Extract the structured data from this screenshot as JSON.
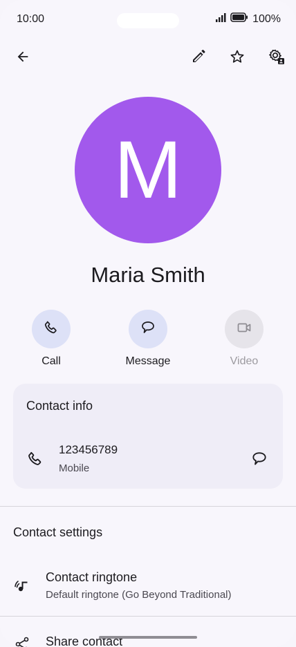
{
  "status_bar": {
    "time": "10:00",
    "battery": "100%"
  },
  "top_bar": {
    "back_icon": "arrow-back-icon",
    "edit_icon": "pencil-icon",
    "favorite_icon": "star-outline-icon",
    "settings_icon": "manage-accounts-icon"
  },
  "contact": {
    "initial": "M",
    "name": "Maria Smith",
    "avatar_color": "#a259ec"
  },
  "actions": [
    {
      "label": "Call",
      "icon": "phone-icon",
      "enabled": true
    },
    {
      "label": "Message",
      "icon": "message-bubble-icon",
      "enabled": true
    },
    {
      "label": "Video",
      "icon": "videocam-icon",
      "enabled": false
    }
  ],
  "contact_info": {
    "title": "Contact info",
    "phone": {
      "number": "123456789",
      "type": "Mobile"
    }
  },
  "contact_settings": {
    "title": "Contact settings",
    "items": [
      {
        "title": "Contact ringtone",
        "subtitle": "Default ringtone (Go Beyond Traditional)",
        "icon": "ringtone-icon"
      },
      {
        "title": "Share contact",
        "icon": "share-icon"
      }
    ]
  },
  "colors": {
    "accent": "#a259ec",
    "action_bg": "#dde1f7",
    "card_bg": "#efedf7"
  }
}
